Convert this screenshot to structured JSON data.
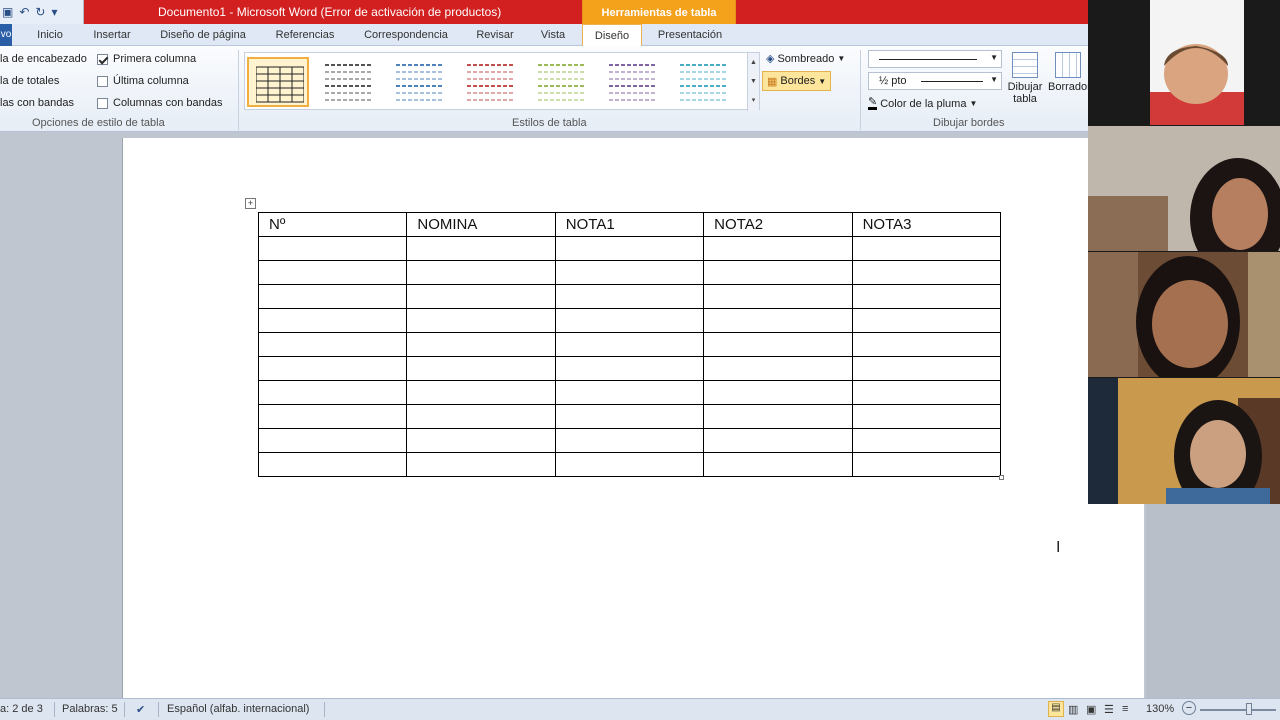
{
  "title_bar": {
    "title": "Documento1  -  Microsoft Word (Error de activación de productos)",
    "context_tab_header": "Herramientas de tabla"
  },
  "tabs": [
    {
      "label": "vo"
    },
    {
      "label": "Inicio"
    },
    {
      "label": "Insertar"
    },
    {
      "label": "Diseño de página"
    },
    {
      "label": "Referencias"
    },
    {
      "label": "Correspondencia"
    },
    {
      "label": "Revisar"
    },
    {
      "label": "Vista"
    },
    {
      "label": "Diseño"
    },
    {
      "label": "Presentación"
    }
  ],
  "ribbon": {
    "style_options": {
      "group_label": "Opciones de estilo de tabla",
      "items": [
        {
          "label": "la de encabezado"
        },
        {
          "label": "la de totales"
        },
        {
          "label": "las con bandas"
        },
        {
          "label": "Primera columna",
          "checked": true
        },
        {
          "label": "Última columna",
          "checked": false
        },
        {
          "label": "Columnas con bandas",
          "checked": false
        }
      ]
    },
    "table_styles": {
      "group_label": "Estilos de tabla",
      "shading_label": "Sombreado",
      "borders_label": "Bordes",
      "thumb_colors": [
        "#222222",
        "#555555",
        "#4f81bd",
        "#c0504d",
        "#9bbb59",
        "#8064a2",
        "#4bacc6"
      ]
    },
    "draw_borders": {
      "group_label": "Dibujar bordes",
      "line_weight": "½ pto",
      "pen_color_label": "Color de la pluma",
      "draw_table_label_1": "Dibujar",
      "draw_table_label_2": "tabla",
      "eraser_label": "Borrador"
    }
  },
  "document": {
    "table": {
      "headers": [
        "Nº",
        "NOMINA",
        "NOTA1",
        "NOTA2",
        "NOTA3"
      ],
      "empty_rows": 10
    }
  },
  "status_bar": {
    "page": "a: 2 de 3",
    "words": "Palabras: 5",
    "language": "Español (alfab. internacional)",
    "zoom": "130%"
  }
}
